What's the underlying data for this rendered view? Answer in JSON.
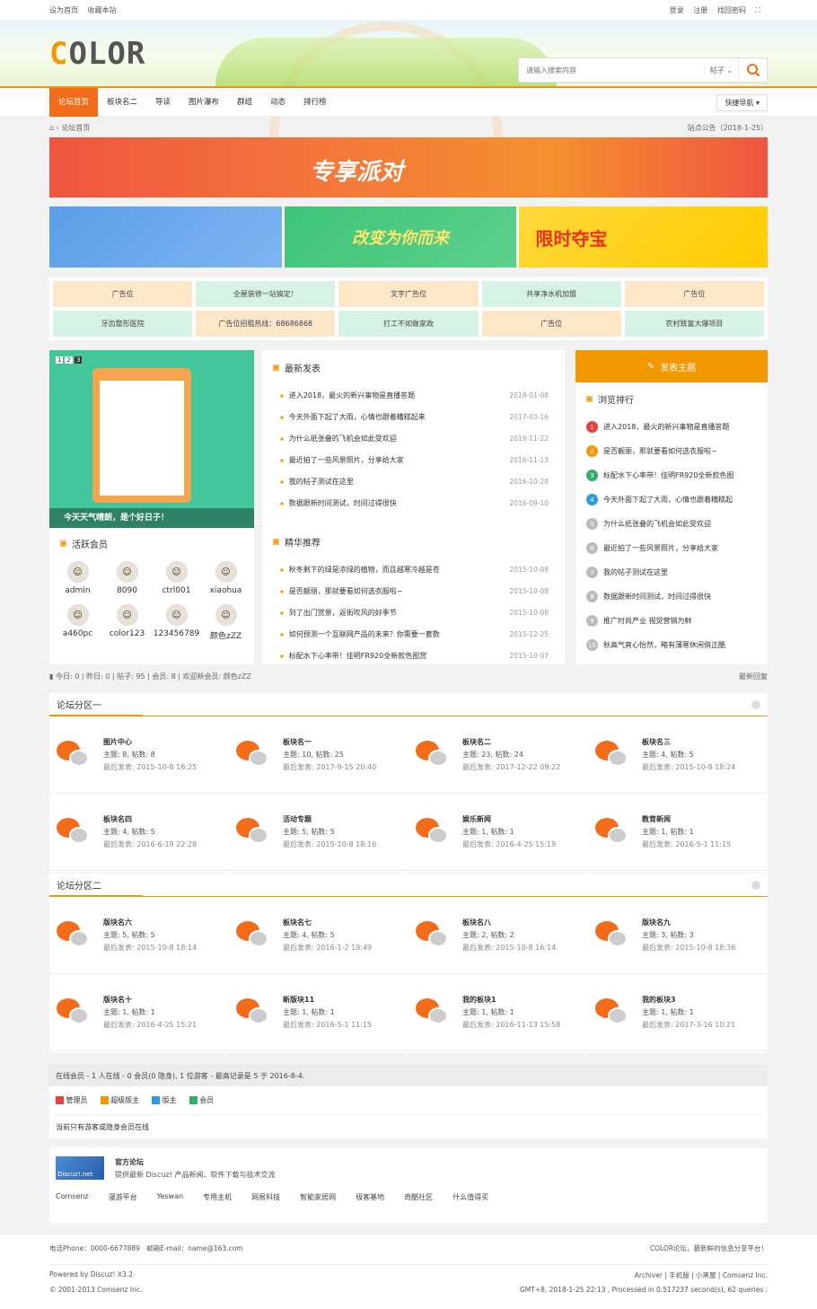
{
  "topbar": {
    "left": [
      "设为首页",
      "收藏本站"
    ],
    "right": [
      "登录",
      "注册",
      "找回密码"
    ]
  },
  "header": {
    "logo": "COLOR",
    "search_placeholder": "请输入搜索内容",
    "search_type": "帖子 ⌄"
  },
  "nav": {
    "items": [
      "论坛首页",
      "板块名二",
      "导读",
      "图片瀑布",
      "群组",
      "动态",
      "排行榜"
    ],
    "quick": "快捷导航 ▾"
  },
  "crumb": {
    "path": "论坛首页",
    "notice": "站点公告（2018-1-25）"
  },
  "banner": {
    "title": "专享派对"
  },
  "promo": [
    "",
    "改变为你而来",
    "限时夺宝"
  ],
  "ads": [
    "广告位",
    "全屋装修一站搞定！",
    "文字广告位",
    "共享净水机加盟",
    "广告位",
    "牙齿整形医院",
    "广告位招租热线：68686868",
    "打工不如做家政",
    "广告位",
    "农村致富大爆项目"
  ],
  "slider": {
    "pager": [
      "1",
      "2",
      "3"
    ],
    "caption": "今天天气晴朗，是个好日子！"
  },
  "active": {
    "title": "活跃会员",
    "members": [
      "admin",
      "8090",
      "ctrl001",
      "xiaohua",
      "a460pc",
      "color123",
      "123456789",
      "颜色zZZ"
    ]
  },
  "latest": {
    "title": "最新发表",
    "rows": [
      {
        "t": "进入2018，最火的新兴事物是直播答题",
        "d": "2018-01-08"
      },
      {
        "t": "今天外面下起了大雨，心情也跟着糟糕起来",
        "d": "2017-03-16"
      },
      {
        "t": "为什么纸张叠的飞机会如此受欢迎",
        "d": "2016-11-22"
      },
      {
        "t": "最近拍了一些风景照片，分享给大家",
        "d": "2016-11-13"
      },
      {
        "t": "我的帖子测试在这里",
        "d": "2016-10-28"
      },
      {
        "t": "数据跟新时间测试，时间过得很快",
        "d": "2016-09-10"
      }
    ]
  },
  "featured": {
    "title": "精华推荐",
    "rows": [
      {
        "t": "秋冬剩下的绿是浓绿的植物，而且越寒冷越是苍",
        "d": "2015-10-08"
      },
      {
        "t": "是否靓丽，那就要看如何选衣服啦~",
        "d": "2015-10-08"
      },
      {
        "t": "到了出门赏景，返街吹风的好季节",
        "d": "2015-10-08"
      },
      {
        "t": "如何预测一个互联网产品的未来？你需要一套数",
        "d": "2015-12-25"
      },
      {
        "t": "标配水下心率带！佳明FR920全新款色图赏",
        "d": "2015-10-07"
      }
    ]
  },
  "post_btn": "发表主题",
  "rank": {
    "title": "浏览排行",
    "rows": [
      "进入2018，最火的新兴事物是直播答题",
      "是否靓丽，那就要看如何选衣服啦~",
      "标配水下心率带！佳明FR920全新款色图",
      "今天外面下起了大雨，心情也跟着糟糕起",
      "为什么纸张叠的飞机会如此受欢迎",
      "最近拍了一些风景照片，分享给大家",
      "我的帖子测试在这里",
      "数据跟新时间测试，时间过得很快",
      "推广时尚产业 视觉营销为鲜",
      "秋高气爽心怡然，略有薄寒休闲俏正酷"
    ],
    "nums": [
      "1",
      "2",
      "3",
      "4",
      "5",
      "6",
      "7",
      "8",
      "9",
      "10"
    ],
    "colors": [
      "#e8413f",
      "#f39800",
      "#31b06b",
      "#2b9be8",
      "#bbbbbb"
    ]
  },
  "stats": {
    "text": "今日: 0 | 昨日: 0 | 帖子: 95 | 会员: 8 | 欢迎新会员: 颜色zZZ",
    "right": "最新回复"
  },
  "zones": [
    {
      "title": "论坛分区一",
      "boards": [
        {
          "n": "图片中心",
          "s": "主题: 8, 帖数: 8",
          "l": "最后发表: 2015-10-8 16:25"
        },
        {
          "n": "板块名一",
          "s": "主题: 10, 帖数: 25",
          "l": "最后发表: 2017-9-15 20:40"
        },
        {
          "n": "板块名二",
          "s": "主题: 23, 帖数: 24",
          "l": "最后发表: 2017-12-22 09:22"
        },
        {
          "n": "板块名三",
          "s": "主题: 4, 帖数: 5",
          "l": "最后发表: 2015-10-8 18:24"
        },
        {
          "n": "板块名四",
          "s": "主题: 4, 帖数: 5",
          "l": "最后发表: 2016-6-19 22:28"
        },
        {
          "n": "活动专题",
          "s": "主题: 5, 帖数: 5",
          "l": "最后发表: 2015-10-8 18:16"
        },
        {
          "n": "娱乐新闻",
          "s": "主题: 1, 帖数: 1",
          "l": "最后发表: 2016-4-25 15:19"
        },
        {
          "n": "教育新闻",
          "s": "主题: 1, 帖数: 1",
          "l": "最后发表: 2016-5-1 11:15"
        }
      ]
    },
    {
      "title": "论坛分区二",
      "boards": [
        {
          "n": "版块名六",
          "s": "主题: 5, 帖数: 5",
          "l": "最后发表: 2015-10-8 18:14"
        },
        {
          "n": "板块名七",
          "s": "主题: 4, 帖数: 5",
          "l": "最后发表: 2016-1-2 19:49"
        },
        {
          "n": "板块名八",
          "s": "主题: 2, 帖数: 2",
          "l": "最后发表: 2015-10-8 16:14"
        },
        {
          "n": "版块名九",
          "s": "主题: 3, 帖数: 3",
          "l": "最后发表: 2015-10-8 18:36"
        },
        {
          "n": "版块名十",
          "s": "主题: 1, 帖数: 1",
          "l": "最后发表: 2016-4-25 15:21"
        },
        {
          "n": "新版块11",
          "s": "主题: 1, 帖数: 1",
          "l": "最后发表: 2016-5-1 11:15"
        },
        {
          "n": "我的板块1",
          "s": "主题: 1, 帖数: 1",
          "l": "最后发表: 2016-11-13 15:58"
        },
        {
          "n": "我的板块3",
          "s": "主题: 1, 帖数: 1",
          "l": "最后发表: 2017-3-16 10:21"
        }
      ]
    }
  ],
  "online": {
    "head": "在线会员 - 1 人在线 - 0 会员(0 隐身), 1 位游客 - 最高记录是 5 于 2016-8-4.",
    "legend": [
      "管理员",
      "超级版主",
      "版主",
      "会员"
    ],
    "legend_colors": [
      "#e8413f",
      "#f39800",
      "#2b9be8",
      "#31b06b"
    ],
    "note": "当前只有游客或隐身会员在线"
  },
  "links": {
    "logo": "Discuz!.net",
    "title": "官方论坛",
    "desc": "提供最新 Discuz! 产品新闻、软件下载与技术交流",
    "items": [
      "Comsenz",
      "漫游平台",
      "Yeswan",
      "专用主机",
      "网易科技",
      "智能家居网",
      "极客基地",
      "奇酷社区",
      "什么值得买"
    ]
  },
  "footer": {
    "phone": "电话Phone：0000-6677889",
    "email": "邮箱E-mail：name@163.com",
    "slogan": "COLOR论坛，最新鲜的信息分享平台！",
    "powered": "Powered by Discuz! X3.2",
    "copy": "© 2001-2013 Comsenz Inc.",
    "right_links": "Archiver | 手机版 | 小黑屋 | Comsenz Inc.",
    "tz": "GMT+8, 2018-1-25 22:13 , Processed in 0.517237 second(s), 62 queries ."
  }
}
